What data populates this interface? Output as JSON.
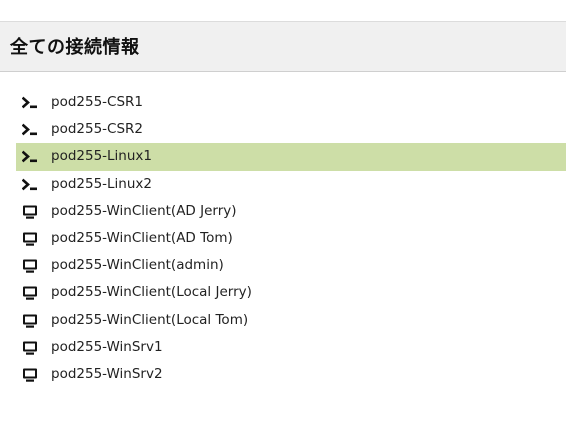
{
  "header": {
    "title": "全ての接続情報"
  },
  "colors": {
    "active_row_bg": "#cddea7"
  },
  "connections": [
    {
      "label": "pod255-CSR1",
      "icon": "terminal-icon",
      "active": false
    },
    {
      "label": "pod255-CSR2",
      "icon": "terminal-icon",
      "active": false
    },
    {
      "label": "pod255-Linux1",
      "icon": "terminal-icon",
      "active": true
    },
    {
      "label": "pod255-Linux2",
      "icon": "terminal-icon",
      "active": false
    },
    {
      "label": "pod255-WinClient(AD Jerry)",
      "icon": "monitor-icon",
      "active": false
    },
    {
      "label": "pod255-WinClient(AD Tom)",
      "icon": "monitor-icon",
      "active": false
    },
    {
      "label": "pod255-WinClient(admin)",
      "icon": "monitor-icon",
      "active": false
    },
    {
      "label": "pod255-WinClient(Local Jerry)",
      "icon": "monitor-icon",
      "active": false
    },
    {
      "label": "pod255-WinClient(Local Tom)",
      "icon": "monitor-icon",
      "active": false
    },
    {
      "label": "pod255-WinSrv1",
      "icon": "monitor-icon",
      "active": false
    },
    {
      "label": "pod255-WinSrv2",
      "icon": "monitor-icon",
      "active": false
    }
  ]
}
